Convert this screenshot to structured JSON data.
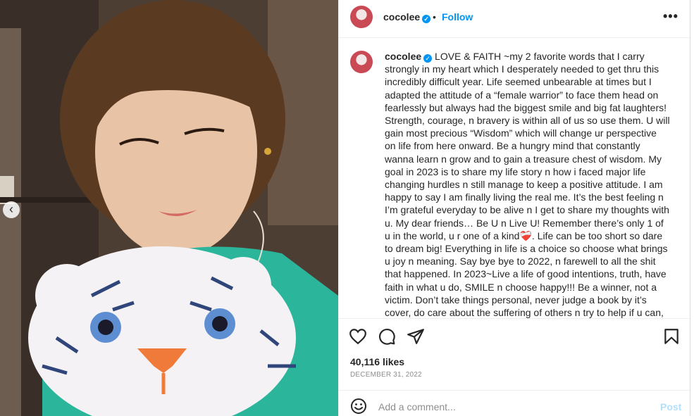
{
  "post": {
    "username": "cocolee",
    "verified_mark": "✓",
    "separator": "•",
    "follow_label": "Follow",
    "more_label": "•••",
    "caption": "LOVE & FAITH ~my 2 favorite words that I carry strongly in my heart which I desperately needed to get thru this incredibly difficult year. Life seemed unbearable at times but I adapted the attitude of a “female warrior” to face them head on fearlessly but always had the biggest smile and big fat laughters! Strength, courage, n bravery is within all of us so use them. U will gain most precious “Wisdom” which will change ur perspective on life from here onward. Be a hungry mind that constantly wanna learn n grow and to gain a treasure chest of wisdom. My goal in 2023 is to share my life story n how i faced major life changing hurdles n still manage to keep a positive attitude. I am happy to say I am finally living the real me. It’s the best feeling n I’m grateful everyday to be alive n I get to share my thoughts with u. My dear friends… Be U n Live U! Remember there’s only 1 of u in the world, u r one of a kind❤️‍🩹. Life can be too short so dare to dream big! Everything in life is a choice so choose what brings u joy n meaning. Say bye bye to 2022, n farewell to all the shit that happened. In 2023~Live a life of good intentions, truth, have faith in what u do, SMILE n choose happy!!! Be a winner, not a victim. Don’t take things personal, never judge a book by it’s cover, do care about the suffering of others n try to help if u can,",
    "likes": "40,116 likes",
    "date": "DECEMBER 31, 2022",
    "comment_placeholder": "Add a comment...",
    "post_label": "Post",
    "prev_label": "‹",
    "carousel_dots": 10,
    "carousel_active_index": 9
  },
  "icons": [
    "heart-icon",
    "comment-icon",
    "share-icon",
    "bookmark-icon",
    "emoji-icon"
  ],
  "colors": {
    "accent": "#0095f6",
    "post_disabled": "#b2dffc",
    "shirt": "#2bb59a"
  }
}
